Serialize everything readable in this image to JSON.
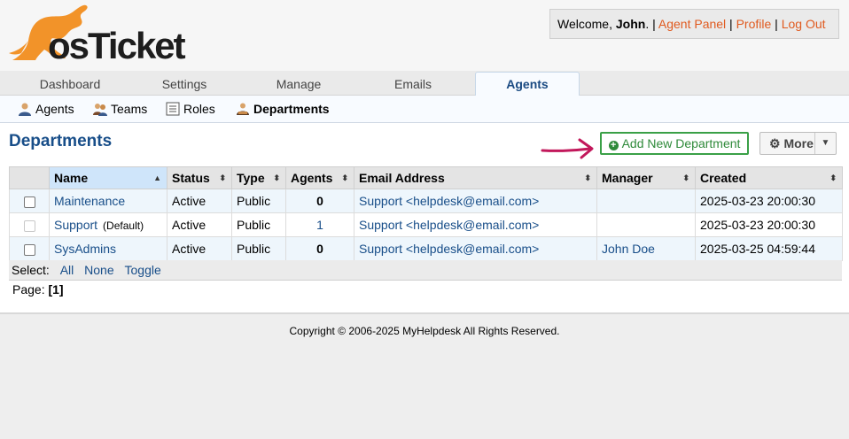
{
  "brand": {
    "logo_text": "osTicket"
  },
  "userbox": {
    "welcome_prefix": "Welcome, ",
    "user_name": "John",
    "welcome_suffix": ". | ",
    "agent_panel": "Agent Panel",
    "profile": "Profile",
    "logout": "Log Out",
    "sep": " | "
  },
  "nav": {
    "tabs": [
      {
        "label": "Dashboard"
      },
      {
        "label": "Settings"
      },
      {
        "label": "Manage"
      },
      {
        "label": "Emails"
      },
      {
        "label": "Agents",
        "active": true
      }
    ]
  },
  "subnav": {
    "items": [
      {
        "label": "Agents",
        "icon": "user-icon"
      },
      {
        "label": "Teams",
        "icon": "team-icon"
      },
      {
        "label": "Roles",
        "icon": "roles-icon"
      },
      {
        "label": "Departments",
        "icon": "department-icon",
        "active": true
      }
    ]
  },
  "page": {
    "title": "Departments",
    "add_button": "Add New Department",
    "more_button": "More"
  },
  "table": {
    "columns": [
      "Name",
      "Status",
      "Type",
      "Agents",
      "Email Address",
      "Manager",
      "Created"
    ],
    "rows": [
      {
        "name": "Maintenance",
        "tag": "",
        "status": "Active",
        "type": "Public",
        "agents": "0",
        "email": "Support <helpdesk@email.com>",
        "manager": "",
        "created": "2025-03-23 20:00:30"
      },
      {
        "name": "Support",
        "tag": "(Default)",
        "status": "Active",
        "type": "Public",
        "agents": "1",
        "email": "Support <helpdesk@email.com>",
        "manager": "",
        "created": "2025-03-23 20:00:30"
      },
      {
        "name": "SysAdmins",
        "tag": "",
        "status": "Active",
        "type": "Public",
        "agents": "0",
        "email": "Support <helpdesk@email.com>",
        "manager": "John Doe",
        "created": "2025-03-25 04:59:44"
      }
    ]
  },
  "select": {
    "label": "Select:",
    "all": "All",
    "none": "None",
    "toggle": "Toggle"
  },
  "pager": {
    "label": "Page:",
    "current": "[1]"
  },
  "footer": {
    "text": "Copyright © 2006-2025 MyHelpdesk All Rights Reserved."
  },
  "colors": {
    "brand_orange": "#f29329",
    "link_blue": "#184e89",
    "add_green": "#2f8a3a",
    "arrow": "#c2185b"
  }
}
